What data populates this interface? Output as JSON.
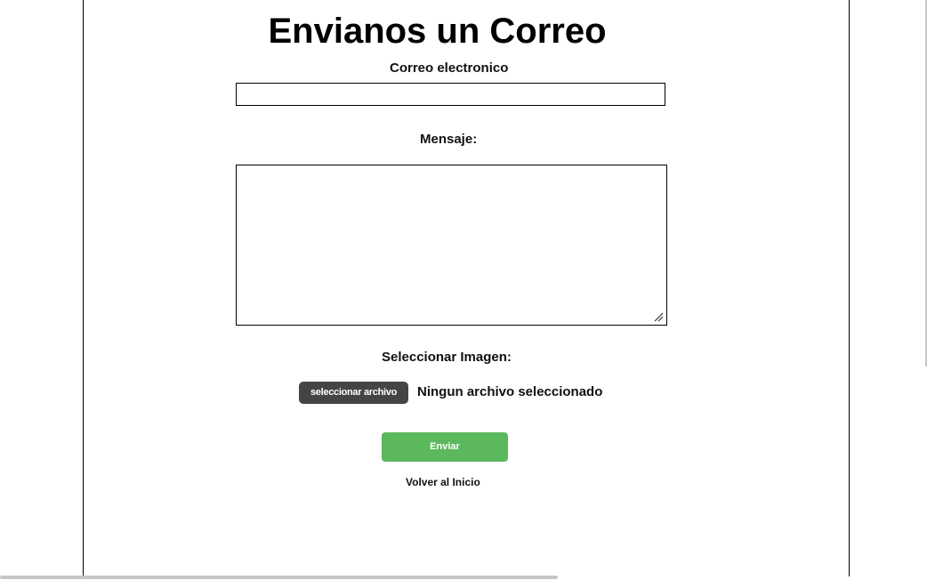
{
  "form": {
    "title": "Envianos un Correo",
    "email_label": "Correo electronico",
    "email_value": "",
    "message_label": "Mensaje:",
    "message_value": "",
    "image_label": "Seleccionar Imagen:",
    "file_button_label": "seleccionar archivo",
    "file_status": "Ningun archivo seleccionado",
    "submit_label": "Enviar",
    "back_link": "Volver al Inicio"
  },
  "colors": {
    "submit_button": "#5cb85c",
    "file_button": "#444444",
    "border": "#000000"
  }
}
